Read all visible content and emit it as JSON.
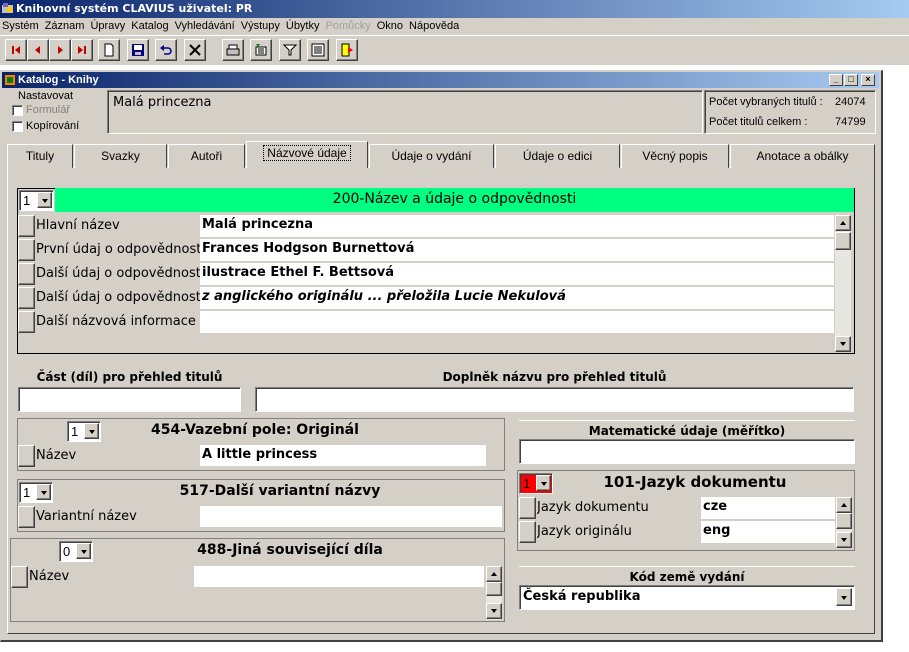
{
  "app": {
    "title": "Knihovní systém CLAVIUS  uživatel: PR",
    "menu": [
      "Systém",
      "Záznam",
      "Úpravy",
      "Katalog",
      "Vyhledávání",
      "Výstupy",
      "Úbytky",
      "Pomůcky",
      "Okno",
      "Nápověda"
    ],
    "menu_disabled_index": 7
  },
  "window": {
    "title": "Katalog - Knihy",
    "nastavovat_label": "Nastavovat",
    "formular_label": "Formulář",
    "kopirovani_label": "Kopírování",
    "record_title": "Malá princezna",
    "selected_titles_label": "Počet vybraných titulů :",
    "selected_titles_value": "24074",
    "total_titles_label": "Počet titulů celkem :",
    "total_titles_value": "74799"
  },
  "tabs": [
    "Tituly",
    "Svazky",
    "Autoři",
    "Názvové údaje",
    "Údaje o vydání",
    "Údaje o edici",
    "Věcný popis",
    "Anotace a obálky"
  ],
  "active_tab_index": 3,
  "section200": {
    "counter": "1",
    "header": "200-Název a údaje o odpovědnosti",
    "header_color": "#00ff80",
    "rows": [
      {
        "label": "Hlavní název",
        "value": "Malá princezna",
        "italic": false
      },
      {
        "label": "První údaj o odpovědnosti",
        "value": "Frances Hodgson Burnettová",
        "italic": false
      },
      {
        "label": "Další údaj o odpovědnosti",
        "value": "ilustrace Ethel F. Bettsová",
        "italic": false
      },
      {
        "label": "Další údaj o odpovědnosti",
        "value": "z anglického originálu ... přeložila Lucie Nekulová",
        "italic": true
      },
      {
        "label": "Další názvová informace",
        "value": "",
        "italic": false
      }
    ]
  },
  "part_label": "Část (díl) pro přehled titulů",
  "part_value": "",
  "supplement_label": "Doplněk názvu pro přehled titulů",
  "supplement_value": "",
  "section454": {
    "counter": "1",
    "header": "454-Vazební pole: Originál",
    "row_label": "Název",
    "row_value": "A little princess"
  },
  "section517": {
    "counter": "1",
    "header": "517-Další variantní názvy",
    "row_label": "Variantní název",
    "row_value": ""
  },
  "section488": {
    "counter": "0",
    "header": "488-Jiná související díla",
    "row_label": "Název",
    "row_value": ""
  },
  "math_label": "Matematické údaje (měřítko)",
  "math_value": "",
  "section101": {
    "counter": "1",
    "counter_color": "#ff0000",
    "header": "101-Jazyk dokumentu",
    "rows": [
      {
        "label": "Jazyk dokumentu",
        "value": "cze"
      },
      {
        "label": "Jazyk originálu",
        "value": "eng"
      }
    ]
  },
  "country_label": "Kód země vydání",
  "country_value": "Česká republika"
}
